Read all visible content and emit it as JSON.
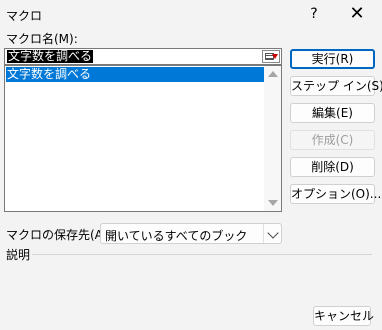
{
  "window": {
    "title": "マクロ",
    "help_label": "?",
    "close_label": "✕"
  },
  "macro_name": {
    "label": "マクロ名(M):",
    "value": "文字数を調べる"
  },
  "macro_list": {
    "items": [
      "文字数を調べる"
    ],
    "selected_index": 0
  },
  "buttons": {
    "run": "実行(R)",
    "step_in": "ステップ イン(S)",
    "edit": "編集(E)",
    "create": "作成(C)",
    "delete": "削除(D)",
    "options": "オプション(O)...",
    "cancel": "キャンセル"
  },
  "store": {
    "label": "マクロの保存先(A):",
    "value": "開いているすべてのブック"
  },
  "description": {
    "label": "説明"
  }
}
